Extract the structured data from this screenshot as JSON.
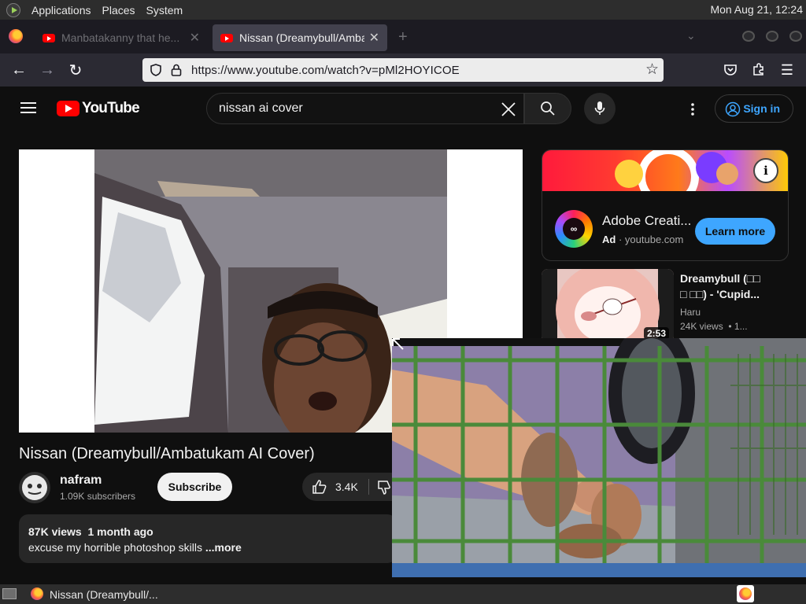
{
  "top_panel": {
    "menus": [
      "Applications",
      "Places",
      "System"
    ],
    "clock": "Mon Aug 21, 12:24"
  },
  "browser": {
    "tabs": [
      {
        "title": "Manbatakanny that he...",
        "active": false
      },
      {
        "title": "Nissan (Dreamybull/Ambatu",
        "active": true
      }
    ],
    "url": "https://www.youtube.com/watch?v=pMl2HOYICOE"
  },
  "youtube": {
    "logo_text": "YouTube",
    "search_value": "nissan ai cover",
    "sign_in_label": "Sign in",
    "video_title": "Nissan (Dreamybull/Ambatukam AI Cover)",
    "channel_name": "nafram",
    "channel_subs": "1.09K subscribers",
    "subscribe_label": "Subscribe",
    "like_count": "3.4K",
    "views": "87K views",
    "age": "1 month ago",
    "description": "excuse my horrible photoshop skills",
    "more_label": "...more"
  },
  "ad": {
    "title": "Adobe Creati...",
    "ad_badge": "Ad",
    "domain": "youtube.com",
    "cta": "Learn more"
  },
  "suggested": {
    "title_line1": "Dreamybull (□□",
    "title_line2": "□ □□) - 'Cupid...",
    "channel": "Haru",
    "meta": "24K views",
    "meta_suffix": "• 1...",
    "duration": "2:53"
  },
  "taskbar": {
    "window_title": "Nissan (Dreamybull/..."
  },
  "colors": {
    "yt_red": "#ff0000",
    "link_blue": "#3ea6ff",
    "panel_bg": "#2d2d2d"
  }
}
